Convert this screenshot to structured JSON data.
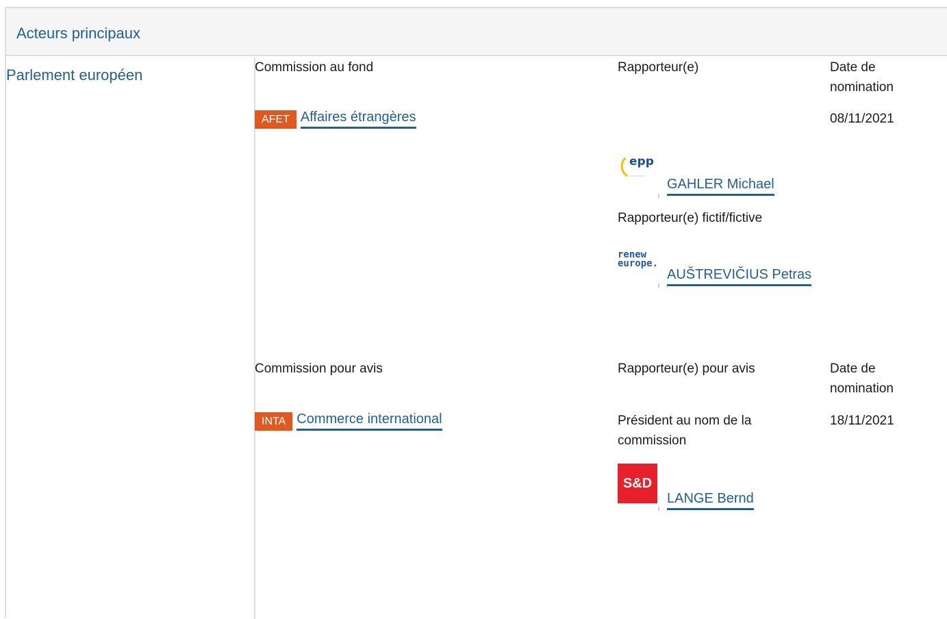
{
  "section": {
    "title": "Acteurs principaux"
  },
  "institution": {
    "label": "Parlement européen"
  },
  "lead_committee": {
    "column_headers": {
      "committee": "Commission au fond",
      "rapporteur": "Rapporteur(e)",
      "date": "Date de nomination"
    },
    "committee": {
      "code": "AFET",
      "name": "Affaires étrangères"
    },
    "date": "08/11/2021",
    "rapporteur": {
      "name": "GAHLER Michael",
      "group_logo": "epp-logo",
      "group_text": "epp"
    },
    "shadow_label": "Rapporteur(e) fictif/fictive",
    "shadow_rapporteur": {
      "name": "AUŠTREVIČIUS Petras",
      "group_logo": "renew-europe-logo",
      "group_text_1": "renew",
      "group_text_2": "europe."
    }
  },
  "opinion_committee": {
    "column_headers": {
      "committee": "Commission pour avis",
      "rapporteur": "Rapporteur(e) pour avis",
      "date": "Date de nomination"
    },
    "committee": {
      "code": "INTA",
      "name": "Commerce international"
    },
    "date": "18/11/2021",
    "role": "Président au nom de la commission",
    "rapporteur": {
      "name": "LANGE Bernd",
      "group_logo": "sd-logo",
      "group_text": "S&D"
    }
  },
  "colors": {
    "link": "#1f5f98",
    "badge": "#e05a1f",
    "sd_red": "#e8202a",
    "border": "#dddddd",
    "header_bg": "#f5f5f5"
  }
}
